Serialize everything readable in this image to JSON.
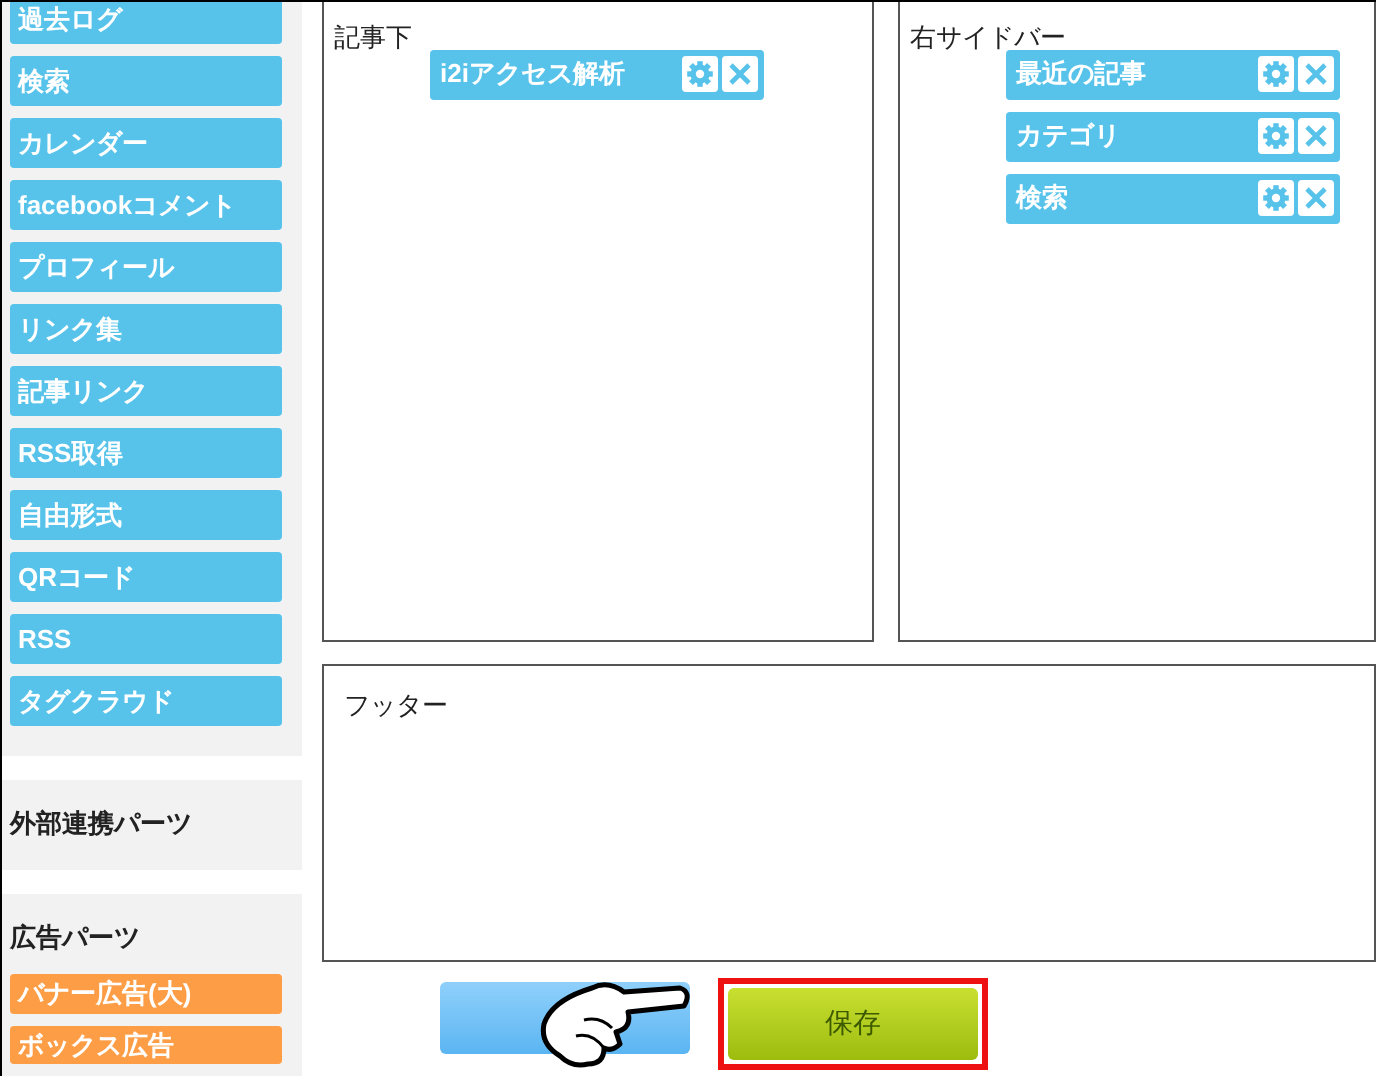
{
  "sidebar": {
    "groups": [
      {
        "kind": "basic",
        "items": [
          "過去ログ",
          "検索",
          "カレンダー",
          "facebookコメント",
          "プロフィール",
          "リンク集",
          "記事リンク",
          "RSS取得",
          "自由形式",
          "QRコード",
          "RSS",
          "タグクラウド"
        ]
      },
      {
        "title": "外部連携パーツ"
      },
      {
        "kind": "ad",
        "title": "広告パーツ",
        "items": [
          "バナー広告(大)",
          "ボックス広告"
        ]
      }
    ]
  },
  "areas": [
    {
      "title": "記事下",
      "widgets": [
        "i2iアクセス解析"
      ]
    },
    {
      "title": "右サイドバー",
      "widgets": [
        "最近の記事",
        "カテゴリ",
        "検索"
      ]
    }
  ],
  "footer": {
    "title": "フッター"
  },
  "buttons": [
    {
      "kind": "secondary",
      "highlighted": false
    },
    {
      "kind": "primary",
      "label": "保存",
      "highlighted": true
    }
  ]
}
